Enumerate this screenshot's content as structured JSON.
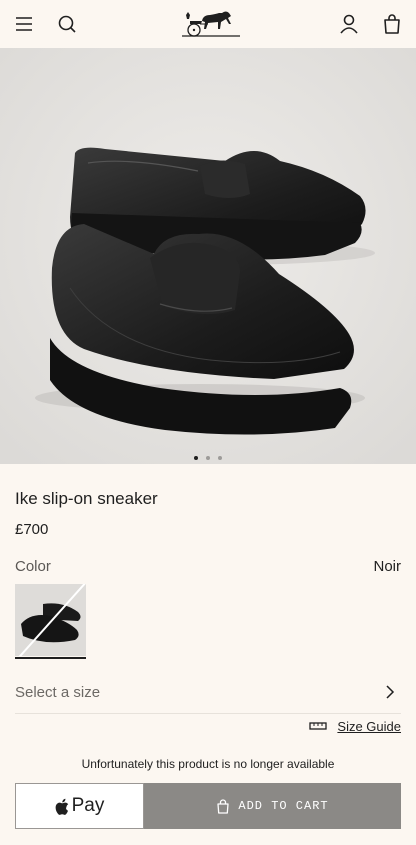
{
  "header": {
    "menu_icon": "hamburger-menu-icon",
    "search_icon": "search-icon",
    "logo": "hermes-carriage-logo",
    "account_icon": "user-icon",
    "bag_icon": "shopping-bag-icon"
  },
  "gallery": {
    "image_count": 3,
    "active_index": 0
  },
  "product": {
    "title": "Ike slip-on sneaker",
    "price": "£700",
    "color_label": "Color",
    "color_value": "Noir"
  },
  "size": {
    "placeholder": "Select a size",
    "guide_label": "Size Guide"
  },
  "availability": "Unfortunately this product is no longer available",
  "actions": {
    "apple_pay_label": "Pay",
    "add_to_cart_label": "ADD TO CART"
  },
  "colors": {
    "background": "#fcf7f1",
    "hero_background": "#e6e4e2",
    "button_disabled": "#8b8986",
    "text": "#1f1f1f"
  }
}
